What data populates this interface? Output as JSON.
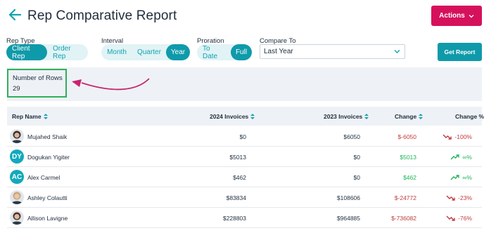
{
  "header": {
    "title": "Rep Comparative Report",
    "actions_label": "Actions"
  },
  "filters": {
    "rep_type": {
      "label": "Rep Type",
      "options": [
        "Client Rep",
        "Order Rep"
      ],
      "selected": "Client Rep"
    },
    "interval": {
      "label": "Interval",
      "options": [
        "Month",
        "Quarter",
        "Year"
      ],
      "selected": "Year"
    },
    "proration": {
      "label": "Proration",
      "options": [
        "To Date",
        "Full"
      ],
      "selected": "Full"
    },
    "compare_to": {
      "label": "Compare To",
      "value": "Last Year"
    },
    "get_report_label": "Get Report"
  },
  "summary": {
    "label": "Number of Rows",
    "value": "29"
  },
  "table": {
    "columns": [
      "Rep Name",
      "2024 Invoices",
      "2023 Invoices",
      "Change",
      "Change %"
    ],
    "rows": [
      {
        "name": "Mujahed Shaik",
        "avatar": "photo",
        "initials": "",
        "inv2024": "$0",
        "inv2023": "$6050",
        "change": "$-6050",
        "pct": "-100%",
        "trend": "down"
      },
      {
        "name": "Dogukan Yigiter",
        "avatar": "initials",
        "initials": "DY",
        "inv2024": "$5013",
        "inv2023": "$0",
        "change": "$5013",
        "pct": "∞%",
        "trend": "up"
      },
      {
        "name": "Alex Carmel",
        "avatar": "initials",
        "initials": "AC",
        "inv2024": "$462",
        "inv2023": "$0",
        "change": "$462",
        "pct": "∞%",
        "trend": "up"
      },
      {
        "name": "Ashley Colautti",
        "avatar": "photo",
        "initials": "",
        "inv2024": "$83834",
        "inv2023": "$108606",
        "change": "$-24772",
        "pct": "-23%",
        "trend": "down"
      },
      {
        "name": "Allison Lavigne",
        "avatar": "photo",
        "initials": "",
        "inv2024": "$228803",
        "inv2023": "$964885",
        "change": "$-736082",
        "pct": "-76%",
        "trend": "down"
      }
    ]
  },
  "colors": {
    "accent": "#0f9aaa",
    "actions": "#d6115c",
    "positive": "#22b35a",
    "negative": "#c23b3b",
    "highlight": "#2fb05a",
    "annotation_arrow": "#c8266e"
  }
}
